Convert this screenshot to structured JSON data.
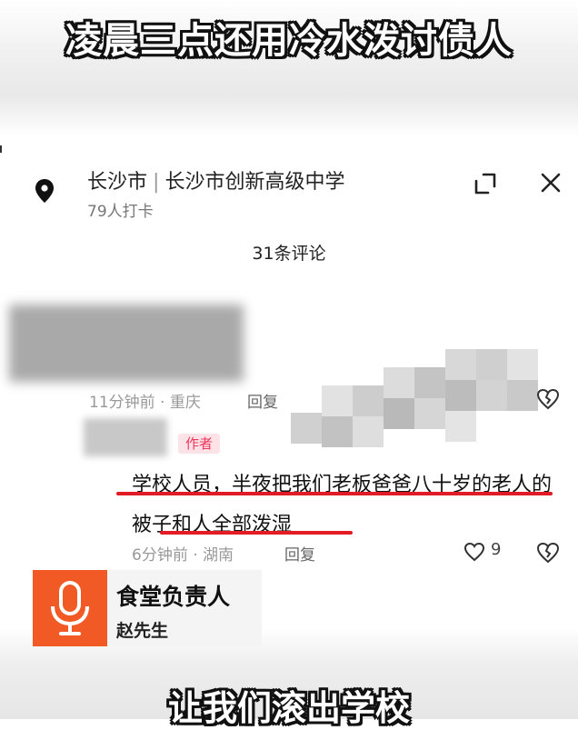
{
  "headline": "凌晨三点还用冷水泼讨债人",
  "location": {
    "city": "长沙市",
    "place": "长沙市创新高级中学",
    "checkins": "79人打卡",
    "icons": [
      "location-pin-icon",
      "expand-icon",
      "close-icon"
    ]
  },
  "comments_count": "31条评论",
  "comment1": {
    "time_region": "11分钟前 · 重庆",
    "reply_label": "回复"
  },
  "comment2": {
    "author_badge": "作者",
    "text": "学校人员，半夜把我们老板爸爸八十岁的老人的被子和人全部泼湿",
    "time_region": "6分钟前 · 湖南",
    "reply_label": "回复",
    "likes": "9"
  },
  "speaker": {
    "name": "食堂负责人",
    "subname": "赵先生",
    "icon": "microphone-icon",
    "icon_color": "#f15a24"
  },
  "subtitle": "让我们滚出学校",
  "colors": {
    "accent_red": "#e21b25",
    "author_badge": "#f1365d"
  }
}
